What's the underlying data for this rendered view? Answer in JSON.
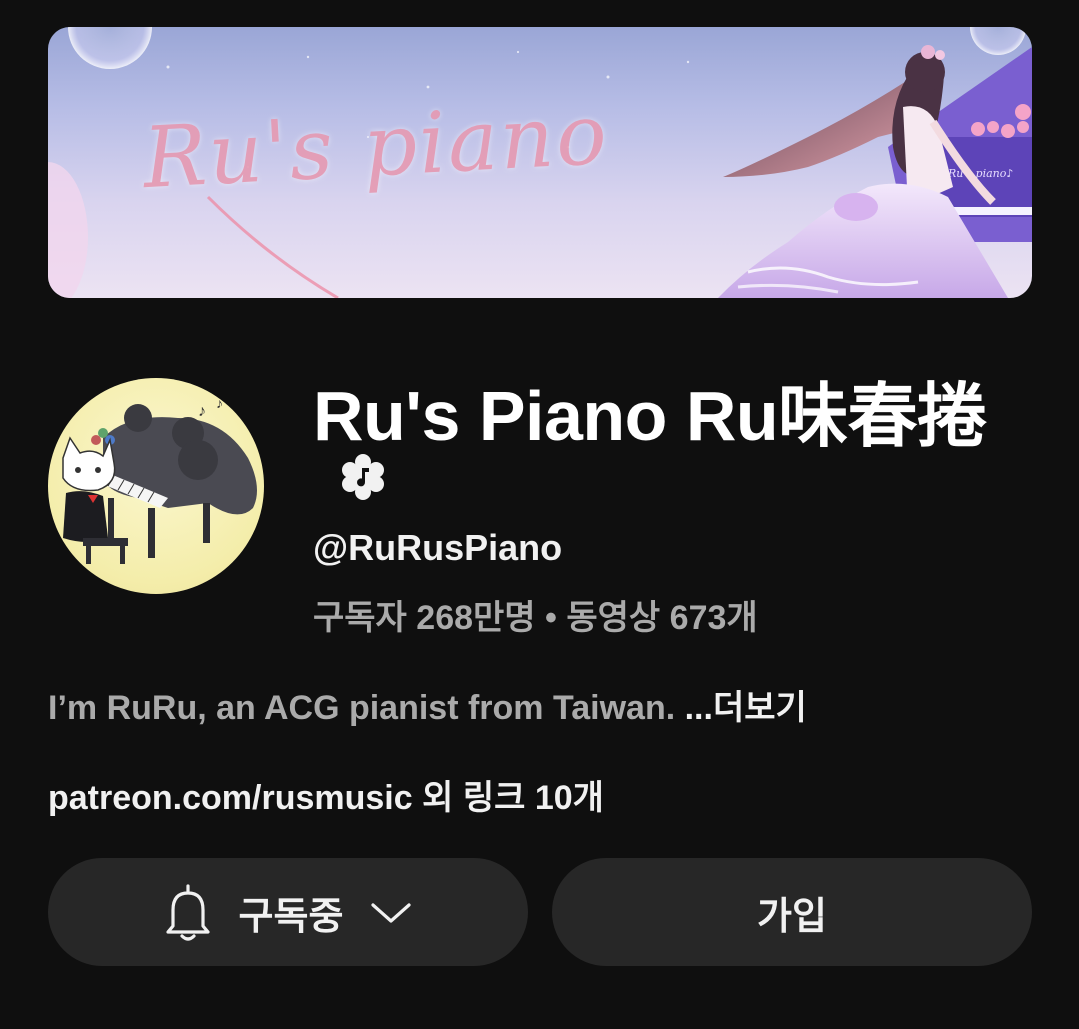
{
  "banner": {
    "text": "Ru's piano",
    "note_glyph": "♪",
    "piano_text": "Ru's piano♪"
  },
  "channel": {
    "name": "Ru's Piano Ru味春捲",
    "badge_icon": "music-note-badge-icon",
    "handle": "@RuRusPiano",
    "stats": "구독자 268만명 • 동영상 673개",
    "description": "I’m RuRu, an ACG pianist from Taiwan. ",
    "more_label": "...더보기",
    "links": "patreon.com/rusmusic 외 링크 10개"
  },
  "actions": {
    "subscribed_label": "구독중",
    "bell_icon": "bell-icon",
    "chevron_icon": "chevron-down-icon",
    "join_label": "가입"
  },
  "colors": {
    "background": "#0f0f0f",
    "button": "#272727",
    "secondary_text": "#aaaaaa",
    "primary_text": "#f1f1f1"
  }
}
